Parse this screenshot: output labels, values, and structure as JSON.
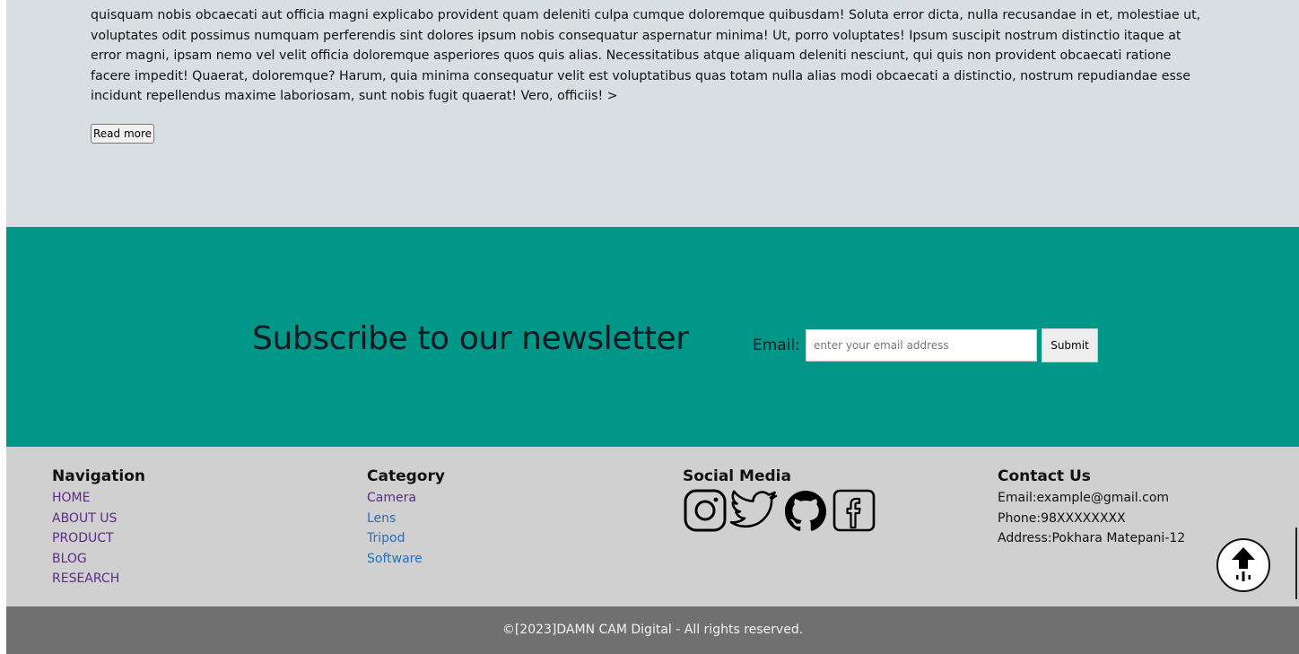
{
  "article": {
    "text": "quisquam nobis obcaecati aut officia magni explicabo provident quam deleniti culpa cumque doloremque quibusdam! Soluta error dicta, nulla recusandae in et, molestiae ut, voluptates odit possimus numquam perferendis sint dolores ipsum nobis consequatur aspernatur minima! Ut, porro voluptates! Ipsum suscipit nostrum distinctio itaque at error magni, ipsam nemo vel velit officia doloremque asperiores quos quis alias. Necessitatibus atque aliquam deleniti nesciunt, qui quis non provident obcaecati ratione facere impedit! Quaerat, doloremque? Harum, quia minima consequatur velit est voluptatibus quas totam nulla alias modi obcaecati a distinctio, nostrum repudiandae esse incidunt repellendus maxime laboriosam, sunt nobis fugit quaerat! Vero, officiis! >",
    "read_more_label": "Read more"
  },
  "newsletter": {
    "title": "Subscribe to our newsletter",
    "email_label": "Email:",
    "email_value": "",
    "email_placeholder": "enter your email address",
    "submit_label": "Submit",
    "background": "#009688"
  },
  "footer": {
    "navigation": {
      "heading": "Navigation",
      "items": [
        "HOME",
        "ABOUT US",
        "PRODUCT",
        "BLOG",
        "RESEARCH"
      ]
    },
    "category": {
      "heading": "Category",
      "items": [
        "Camera",
        "Lens",
        "Tripod",
        "Software"
      ]
    },
    "social": {
      "heading": "Social Media",
      "icons": [
        "instagram-icon",
        "twitter-icon",
        "github-icon",
        "facebook-icon"
      ]
    },
    "contact": {
      "heading": "Contact Us",
      "email": "Email:example@gmail.com",
      "phone": "Phone:98XXXXXXXX",
      "address": "Address:Pokhara Matepani-12"
    }
  },
  "copyright": "©[2023]DAMN CAM Digital - All rights reserved.",
  "colors": {
    "article_bg": "#d8dfe2",
    "footer_bg": "#d0d0d0",
    "copyright_bg": "#707070",
    "link_visited": "#5b2a86",
    "link": "#1f6fc5"
  }
}
